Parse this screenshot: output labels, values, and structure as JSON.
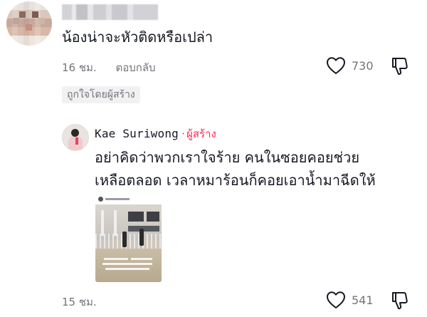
{
  "comment": {
    "text": "น้องน่าจะหัวติดหรือเปล่า",
    "time": "16 ชม.",
    "reply_label": "ตอบกลับ",
    "like_count": "730",
    "creator_badge": "ถูกใจโดยผู้สร้าง"
  },
  "reply": {
    "author": "Kae Suriwong",
    "separator": "·",
    "creator_label": "ผู้สร้าง",
    "text": "อย่าคิดว่าพวกเราใจร้าย คนในซอยคอยช่วย\nเหลือตลอด เวลาหมาร้อนก็คอยเอาน้ำมาฉีดให้",
    "time": "15 ชม.",
    "like_count": "541"
  },
  "colors": {
    "creator_accent": "#fe2c55",
    "meta_gray": "#73747b",
    "text_dark": "#161823"
  },
  "icons": {
    "like": "heart-outline-icon",
    "dislike": "thumbs-down-icon"
  }
}
